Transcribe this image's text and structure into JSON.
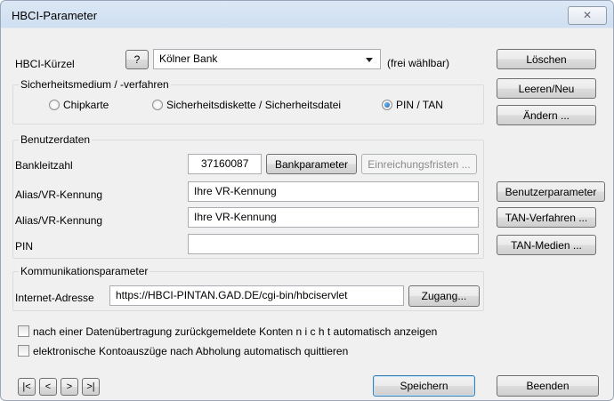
{
  "window": {
    "title": "HBCI-Parameter",
    "close_glyph": "✕"
  },
  "kuerzel": {
    "label": "HBCI-Kürzel",
    "help": "?",
    "value": "Kölner Bank",
    "hint": "(frei wählbar)"
  },
  "security": {
    "title": "Sicherheitsmedium / -verfahren",
    "options": [
      "Chipkarte",
      "Sicherheitsdiskette / Sicherheitsdatei",
      "PIN / TAN"
    ],
    "selected": "PIN / TAN"
  },
  "userdata": {
    "title": "Benutzerdaten",
    "blz_label": "Bankleitzahl",
    "blz_value": "37160087",
    "bankparameter": "Bankparameter",
    "einreichungsfristen": "Einreichungsfristen ...",
    "alias1_label": "Alias/VR-Kennung",
    "alias1_value": "Ihre VR-Kennung",
    "alias2_label": "Alias/VR-Kennung",
    "alias2_value": "Ihre VR-Kennung",
    "pin_label": "PIN",
    "pin_value": ""
  },
  "comm": {
    "title": "Kommunikationsparameter",
    "url_label": "Internet-Adresse",
    "url_value": "https://HBCI-PINTAN.GAD.DE/cgi-bin/hbciservlet",
    "zugang": "Zugang..."
  },
  "checks": {
    "c1": "nach einer Datenübertragung zurückgemeldete Konten  n i c h t  automatisch anzeigen",
    "c2": "elektronische Kontoauszüge nach Abholung automatisch quittieren"
  },
  "side": {
    "loeschen": "Löschen",
    "leeren": "Leeren/Neu",
    "aendern": "Ändern ...",
    "benutzerparameter": "Benutzerparameter",
    "tanverfahren": "TAN-Verfahren ...",
    "tanmedien": "TAN-Medien ..."
  },
  "nav": {
    "first": "|<",
    "prev": "<",
    "next": ">",
    "last": ">|"
  },
  "footer": {
    "speichern": "Speichern",
    "beenden": "Beenden"
  }
}
